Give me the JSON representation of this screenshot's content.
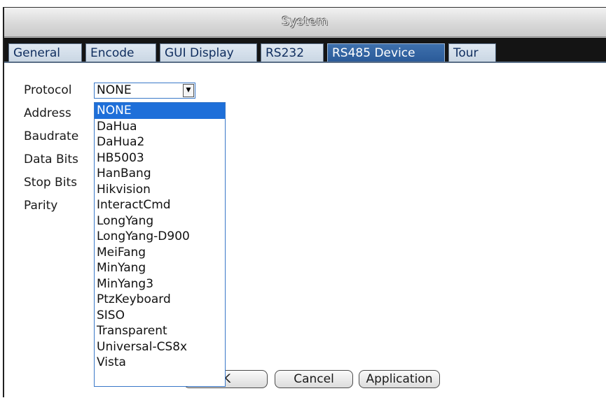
{
  "window": {
    "title": "System"
  },
  "tabs": [
    {
      "label": "General"
    },
    {
      "label": "Encode"
    },
    {
      "label": "GUI Display"
    },
    {
      "label": "RS232"
    },
    {
      "label": "RS485 Device"
    },
    {
      "label": "Tour"
    }
  ],
  "active_tab": "RS485 Device",
  "form": {
    "labels": [
      "Protocol",
      "Address",
      "Baudrate",
      "Data Bits",
      "Stop Bits",
      "Parity"
    ],
    "protocol_value": "NONE"
  },
  "protocol_options": [
    "NONE",
    "DaHua",
    "DaHua2",
    "HB5003",
    "HanBang",
    "Hikvision",
    "InteractCmd",
    "LongYang",
    "LongYang-D900",
    "MeiFang",
    "MinYang",
    "MinYang3",
    "PtzKeyboard",
    "SISO",
    "Transparent",
    "Universal-CS8x",
    "Vista"
  ],
  "selected_option": "NONE",
  "buttons": {
    "ok": "OK",
    "ok_visible": "K",
    "cancel": "Cancel",
    "apply": "Application"
  },
  "colors": {
    "accent": "#1e6fd9",
    "active_tab": "#2f62a3",
    "tab_text": "#0f2d5e"
  }
}
